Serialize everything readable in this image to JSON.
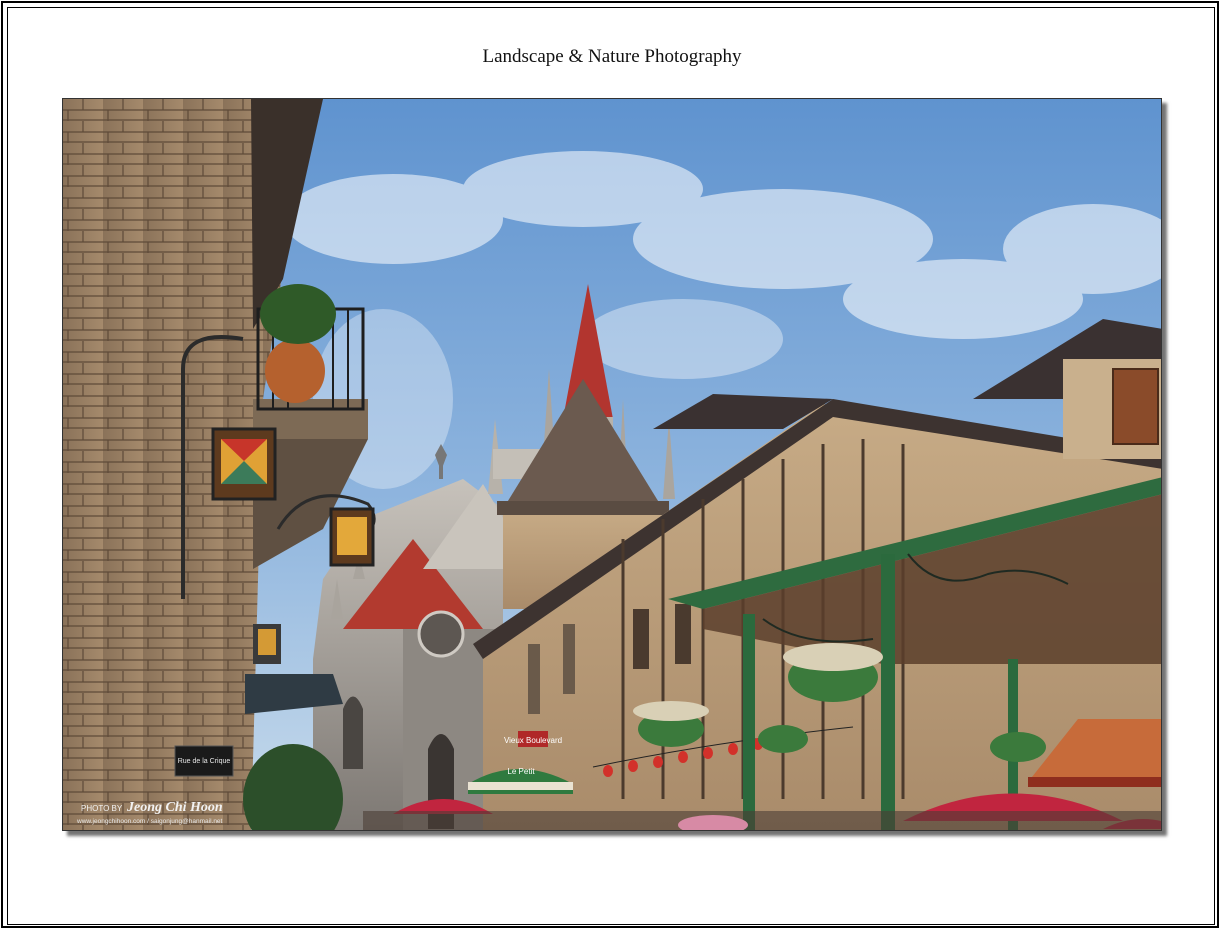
{
  "page": {
    "title": "Landscape & Nature Photography"
  },
  "photo": {
    "subject": "European-style street with gothic cathedral spire, stone buildings, lanterns and green gazebo",
    "signs": {
      "street_plaque": "Rue de la Crique",
      "shop_sign": "Vieux Boulevard",
      "cafe_awning": "Le Petit"
    },
    "watermark": {
      "prefix": "PHOTO BY",
      "name": "Jeong Chi Hoon",
      "contact": "www.jeongchihoon.com / saigonjung@hanmail.net"
    }
  },
  "colors": {
    "sky_top": "#5f93cf",
    "sky_bottom": "#c9dcec",
    "stone": "#a08568",
    "spire_red": "#b2352f",
    "gazebo_green": "#2e6b3f",
    "umbrella_red": "#c1253f"
  }
}
